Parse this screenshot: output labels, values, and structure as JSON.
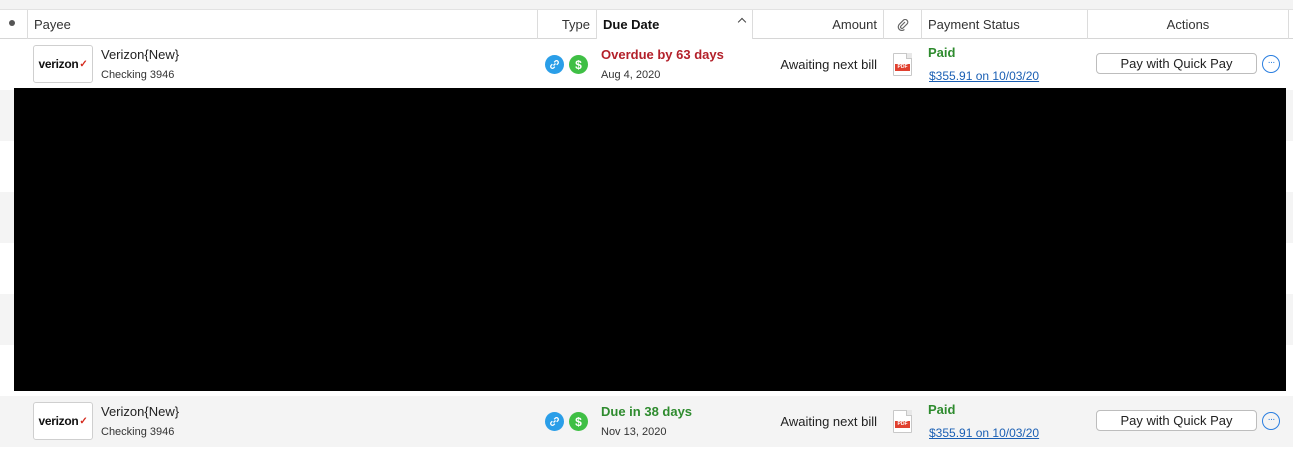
{
  "header": {
    "payee": "Payee",
    "type": "Type",
    "due_date": "Due Date",
    "amount": "Amount",
    "payment_status": "Payment Status",
    "actions": "Actions"
  },
  "rows": [
    {
      "logo_text": "verizon",
      "logo_mark": "✓",
      "payee_name": "Verizon{New}",
      "account": "Checking 3946",
      "type_icons": [
        "link-icon",
        "dollar-icon"
      ],
      "due_status": "Overdue by 63 days",
      "due_status_color": "#b3202a",
      "due_date": "Aug 4, 2020",
      "amount": "Awaiting next bill",
      "attachment": "PDF",
      "payment_status": "Paid",
      "payment_detail": "$355.91 on 10/03/20",
      "action_label": "Pay with Quick Pay",
      "more_label": "···"
    },
    {
      "logo_text": "verizon",
      "logo_mark": "✓",
      "payee_name": "Verizon{New}",
      "account": "Checking 3946",
      "type_icons": [
        "link-icon",
        "dollar-icon"
      ],
      "due_status": "Due in 38 days",
      "due_status_color": "#2e8b2e",
      "due_date": "Nov 13, 2020",
      "amount": "Awaiting next bill",
      "attachment": "PDF",
      "payment_status": "Paid",
      "payment_detail": "$355.91 on 10/03/20",
      "action_label": "Pay with Quick Pay",
      "more_label": "···"
    }
  ]
}
